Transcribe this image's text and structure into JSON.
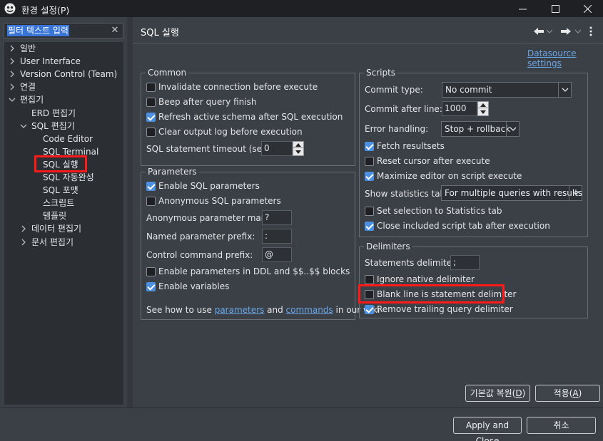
{
  "window": {
    "title": "환경 설정(P)",
    "controls": {
      "minimize": "—",
      "maximize": "□",
      "close": "✕"
    }
  },
  "filter": {
    "value": "필터 텍스트 입력",
    "clear": "✕"
  },
  "tree": [
    {
      "label": "일반",
      "indent": 0,
      "expander": "collapsed"
    },
    {
      "label": "User Interface",
      "indent": 0,
      "expander": "collapsed"
    },
    {
      "label": "Version Control (Team)",
      "indent": 0,
      "expander": "collapsed"
    },
    {
      "label": "연결",
      "indent": 0,
      "expander": "collapsed"
    },
    {
      "label": "편집기",
      "indent": 0,
      "expander": "expanded"
    },
    {
      "label": "ERD 편집기",
      "indent": 1,
      "expander": "none"
    },
    {
      "label": "SQL 편집기",
      "indent": 1,
      "expander": "expanded"
    },
    {
      "label": "Code Editor",
      "indent": 2,
      "expander": "none"
    },
    {
      "label": "SQL Terminal",
      "indent": 2,
      "expander": "none"
    },
    {
      "label": "SQL 실행",
      "indent": 2,
      "expander": "none",
      "selected": true
    },
    {
      "label": "SQL 자동완성",
      "indent": 2,
      "expander": "none"
    },
    {
      "label": "SQL 포맷",
      "indent": 2,
      "expander": "none"
    },
    {
      "label": "스크립트",
      "indent": 2,
      "expander": "none"
    },
    {
      "label": "템플릿",
      "indent": 2,
      "expander": "none"
    },
    {
      "label": "데이터 편집기",
      "indent": 1,
      "expander": "collapsed"
    },
    {
      "label": "문서 편집기",
      "indent": 1,
      "expander": "collapsed"
    }
  ],
  "page": {
    "title": "SQL 실행",
    "datasource_link": "Datasource settings"
  },
  "common": {
    "title": "Common",
    "invalidate": "Invalidate connection before execute",
    "beep": "Beep after query finish",
    "refresh": "Refresh active schema after SQL execution",
    "clear_log": "Clear output log before execution",
    "timeout_label": "SQL statement timeout (sec):",
    "timeout_value": "0"
  },
  "parameters": {
    "title": "Parameters",
    "enable_sql": "Enable SQL parameters",
    "anon_sql": "Anonymous SQL parameters",
    "anon_mark_label": "Anonymous parameter mark:",
    "anon_mark_value": "?",
    "named_prefix_label": "Named parameter prefix:",
    "named_prefix_value": ":",
    "control_prefix_label": "Control command prefix:",
    "control_prefix_value": "@",
    "ddl_blocks": "Enable parameters in DDL and $$..$$ blocks",
    "enable_vars": "Enable variables",
    "help_pre": "See how to use ",
    "help_link1": "parameters",
    "help_mid": " and ",
    "help_link2": "commands",
    "help_post": " in our wiki"
  },
  "scripts": {
    "title": "Scripts",
    "commit_type_label": "Commit type:",
    "commit_type_value": "No commit",
    "commit_after_label": "Commit after line:",
    "commit_after_value": "1000",
    "error_label": "Error handling:",
    "error_value": "Stop + rollback",
    "fetch": "Fetch resultsets",
    "reset_cursor": "Reset cursor after execute",
    "maximize": "Maximize editor on script execute",
    "show_stats_label": "Show statistics tab:",
    "show_stats_value": "For multiple queries with results",
    "set_selection": "Set selection to Statistics tab",
    "close_tab": "Close included script tab after execution"
  },
  "delimiters": {
    "title": "Delimiters",
    "stmt_label": "Statements delimiter:",
    "stmt_value": ";",
    "ignore_native": "Ignore native delimiter",
    "blank_line": "Blank line is statement delimiter",
    "remove_trailing": "Remove trailing query delimiter"
  },
  "buttons": {
    "restore_prefix": "기본값 복원(",
    "restore_key": "D",
    "restore_suffix": ")",
    "apply_prefix": "적용(",
    "apply_key": "A",
    "apply_suffix": ")",
    "apply_close": "Apply and Close",
    "cancel": "취소"
  },
  "colors": {
    "accent": "#4a8fe0",
    "highlight": "#ff1a1a",
    "link": "#6aa7e8",
    "background": "#3b3f46"
  }
}
